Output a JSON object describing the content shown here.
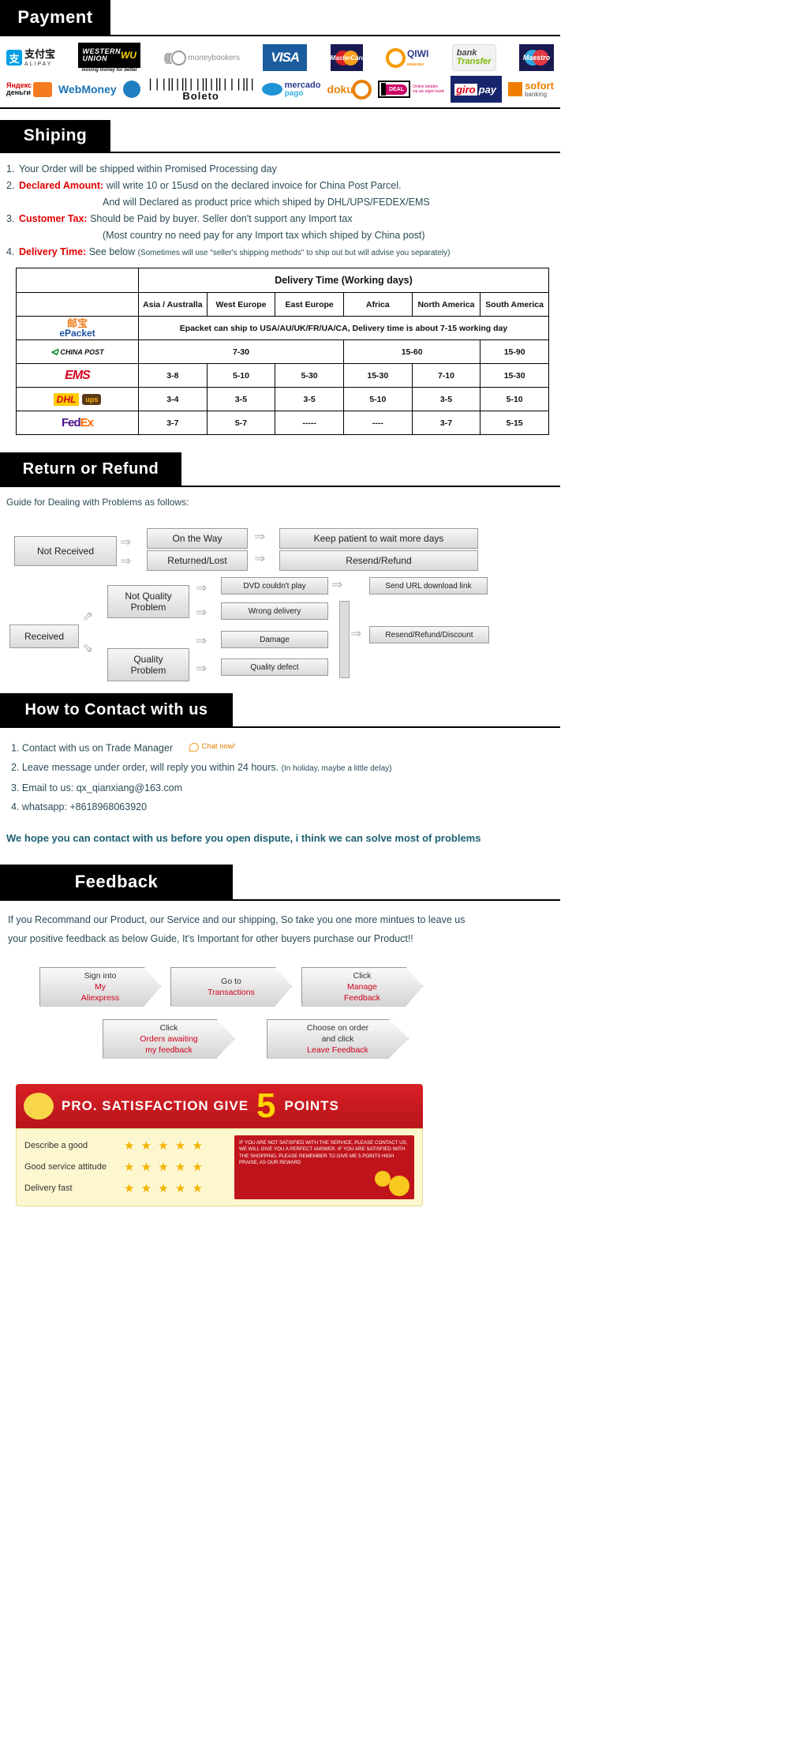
{
  "sections": {
    "payment": {
      "title": "Payment"
    },
    "shipping": {
      "title": "Shiping"
    },
    "return": {
      "title": "Return or Refund"
    },
    "contact": {
      "title": "How to Contact with us"
    },
    "feedback": {
      "title": "Feedback"
    }
  },
  "payment_logos_row1": [
    {
      "name": "alipay",
      "cn": "支付宝",
      "en": "ALIPAY",
      "mark": "支"
    },
    {
      "name": "western-union",
      "l1": "WESTERN",
      "l2": "UNION",
      "wu": "WU",
      "sub": "moving money for better"
    },
    {
      "name": "moneybookers",
      "label": "moneybookers"
    },
    {
      "name": "visa",
      "label": "VISA"
    },
    {
      "name": "mastercard",
      "label": "MasterCard"
    },
    {
      "name": "qiwi",
      "label": "QIWI",
      "sub": "кошелек"
    },
    {
      "name": "bank-transfer",
      "l1": "bank",
      "l2": "Transfer"
    },
    {
      "name": "maestro",
      "label": "Maestro"
    }
  ],
  "payment_logos_row2": [
    {
      "name": "yandex-money",
      "l1": "Яндекс",
      "l2": "деньги"
    },
    {
      "name": "webmoney",
      "label": "WebMoney"
    },
    {
      "name": "boleto",
      "label": "Boleto"
    },
    {
      "name": "mercado-pago",
      "l1": "mercado",
      "l2": "pago"
    },
    {
      "name": "doku",
      "label": "doku"
    },
    {
      "name": "ideal",
      "label": "DEAL",
      "cap1": "Online betalen",
      "cap2": "via uw eigen bank"
    },
    {
      "name": "giropay",
      "g1": "giro",
      "g2": "pay"
    },
    {
      "name": "sofort",
      "s1": "sofort",
      "s2": "banking"
    }
  ],
  "shipping_policy": [
    {
      "num": "1.",
      "bold": "",
      "text": "Your Order will be shipped within Promised Processing day"
    },
    {
      "num": "2.",
      "bold": "Declared Amount:",
      "text": "will write 10 or 15usd on the declared invoice for China Post Parcel."
    },
    {
      "num": "",
      "bold": "",
      "text": "And will Declared as product price which shiped by DHL/UPS/FEDEX/EMS",
      "indent": true
    },
    {
      "num": "3.",
      "bold": "Customer Tax:",
      "text": "Should be Paid by buyer. Seller don't support any Import tax"
    },
    {
      "num": "",
      "bold": "",
      "text": "(Most country no need pay for any Import tax which shiped by China post)",
      "indent": true
    },
    {
      "num": "4.",
      "bold": "Delivery Time:",
      "text": "See below",
      "note": "(Sometimes will use \"seller's shipping methods\" to ship out but will advise you separately)"
    }
  ],
  "delivery_table": {
    "main_header": "Delivery Time (Working days)",
    "regions": [
      "Asia / Australla",
      "West Europe",
      "East Europe",
      "Africa",
      "North America",
      "South America"
    ],
    "rows": [
      {
        "carrier": "ePacket",
        "carrier_cn": "邮宝",
        "span_note": "Epacket can ship to USA/AU/UK/FR/UA/CA, Delivery time is about 7-15 working day",
        "values": []
      },
      {
        "carrier": "CHINA POST",
        "values": [
          "7-30",
          "15-60",
          "15-90"
        ],
        "merged": [
          3,
          2,
          1
        ]
      },
      {
        "carrier": "EMS",
        "values": [
          "3-8",
          "5-10",
          "5-30",
          "15-30",
          "7-10",
          "15-30"
        ]
      },
      {
        "carrier": "DHL ups",
        "values": [
          "3-4",
          "3-5",
          "3-5",
          "5-10",
          "3-5",
          "5-10"
        ]
      },
      {
        "carrier": "FedEx",
        "values": [
          "3-7",
          "5-7",
          "-----",
          "----",
          "3-7",
          "5-15"
        ]
      }
    ]
  },
  "return_flow": {
    "guide_title": "Guide for Dealing with Problems as follows:",
    "not_received": "Not Received",
    "on_the_way": "On the Way",
    "returned_lost": "Returned/Lost",
    "keep_patient": "Keep patient to wait more days",
    "resend_refund": "Resend/Refund",
    "received": "Received",
    "not_quality": "Not Quality\nProblem",
    "not_quality_l1": "Not Quality",
    "not_quality_l2": "Problem",
    "quality_l1": "Quality",
    "quality_l2": "Problem",
    "dvd": "DVD couldn't play",
    "wrong_delivery": "Wrong delivery",
    "damage": "Damage",
    "quality_defect": "Quality defect",
    "send_url": "Send URL download link",
    "resend_refund_discount": "Resend/Refund/Discount"
  },
  "contact": {
    "items": [
      {
        "num": "1.",
        "text": "Contact with us on Trade Manager",
        "chat": "Chat now!"
      },
      {
        "num": "2.",
        "text": "Leave message under order, will reply you within 24 hours.",
        "note": "(In holiday, maybe a little delay)"
      },
      {
        "num": "3.",
        "text": "Email to us: qx_qianxiang@163.com"
      },
      {
        "num": "4.",
        "text": "whatsapp: +8618968063920"
      }
    ],
    "hope": "We hope you can contact with us before you open dispute, i think we can solve most of problems"
  },
  "feedback": {
    "intro_l1": "If you Recommand our Product, our Service and our shipping, So take you one more mintues to leave us",
    "intro_l2": "your positive feedback as below Guide, It's Important for other buyers purchase our Product!!",
    "steps": [
      {
        "l1": "Sign into",
        "l2": "My",
        "l3": "Aliexpress",
        "hi2": true,
        "hi3": true
      },
      {
        "l1": "Go to",
        "l2": "Transactions",
        "hi2": true
      },
      {
        "l1": "Click",
        "l2": "Manage",
        "l3": "Feedback",
        "hi2": true,
        "hi3": true
      },
      {
        "l1": "Click",
        "l2": "Orders awaiting",
        "l3": "my feedback",
        "hi2": true,
        "hi3": true
      },
      {
        "l1": "Choose on order",
        "l2": "and click",
        "l3": "Leave Feedback",
        "hi3": true
      }
    ],
    "promo_text_1": "PRO. SATISFACTION  GIVE",
    "promo_big": "5",
    "promo_text_2": "POINTS",
    "ratings": [
      {
        "label": "Describe a good",
        "stars": 5
      },
      {
        "label": "Good service attitude",
        "stars": 5
      },
      {
        "label": "Delivery fast",
        "stars": 5
      }
    ],
    "red_note": "IF YOU ARE NOT SATISFIED WITH THE SERVICE, PLEASE CONTACT US, WE WILL GIVE YOU A PERFECT ANSWER. IF YOU ARE SATISFIED WITH THE SHOPPING, PLEASE REMEMBER TO GIVE ME 5 POINTS HIGH PRAISE, AS OUR REWARD"
  },
  "colors": {
    "accent_red": "#e00000",
    "teal": "#2b4c57",
    "star": "#f5b301"
  }
}
